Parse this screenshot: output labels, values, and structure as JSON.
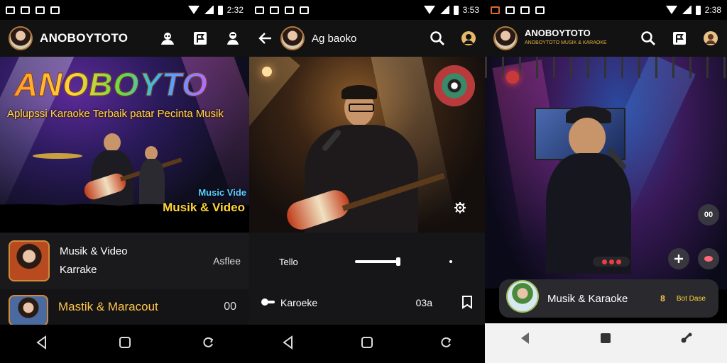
{
  "status": {
    "p1_time": "2:32",
    "p2_time": "3:53",
    "p3_time": "2:38"
  },
  "panel1": {
    "app_title": "ANOBOYTOTO",
    "hero": {
      "brand": "ANOBOYTO",
      "tagline": "Aplupssi Karaoke Terbaik patar Pecinta Musik",
      "badge_small": "Music Vide",
      "badge_large": "Musik & Video"
    },
    "row1": {
      "line1": "Musik & Video",
      "line2": "Karrake",
      "right": "Asflee"
    },
    "row2": {
      "title": "Mastik & Maracout",
      "right": "00"
    }
  },
  "panel2": {
    "title": "Ag baoko",
    "control_label": "Tello",
    "row2_label": "Karoeke",
    "row2_count": "03a"
  },
  "panel3": {
    "app_title": "ANOBOYTOTO",
    "app_subtitle": "ANOBOYTOTO MUSIK & KARAOKE",
    "badge_right": "00",
    "card": {
      "title": "Musik & Karaoke",
      "tag": "Bot Dase",
      "emoji_badge": "8"
    }
  },
  "colors": {
    "accent_gold": "#ffd43a",
    "accent_orange": "#ff9a2a",
    "text_primary": "#ffffff"
  },
  "icons": [
    "profile-icon",
    "flag-icon",
    "user-icon",
    "back-arrow-icon",
    "search-icon",
    "settings-gear-icon",
    "bookmark-icon",
    "home-icon",
    "recent-apps-icon"
  ]
}
